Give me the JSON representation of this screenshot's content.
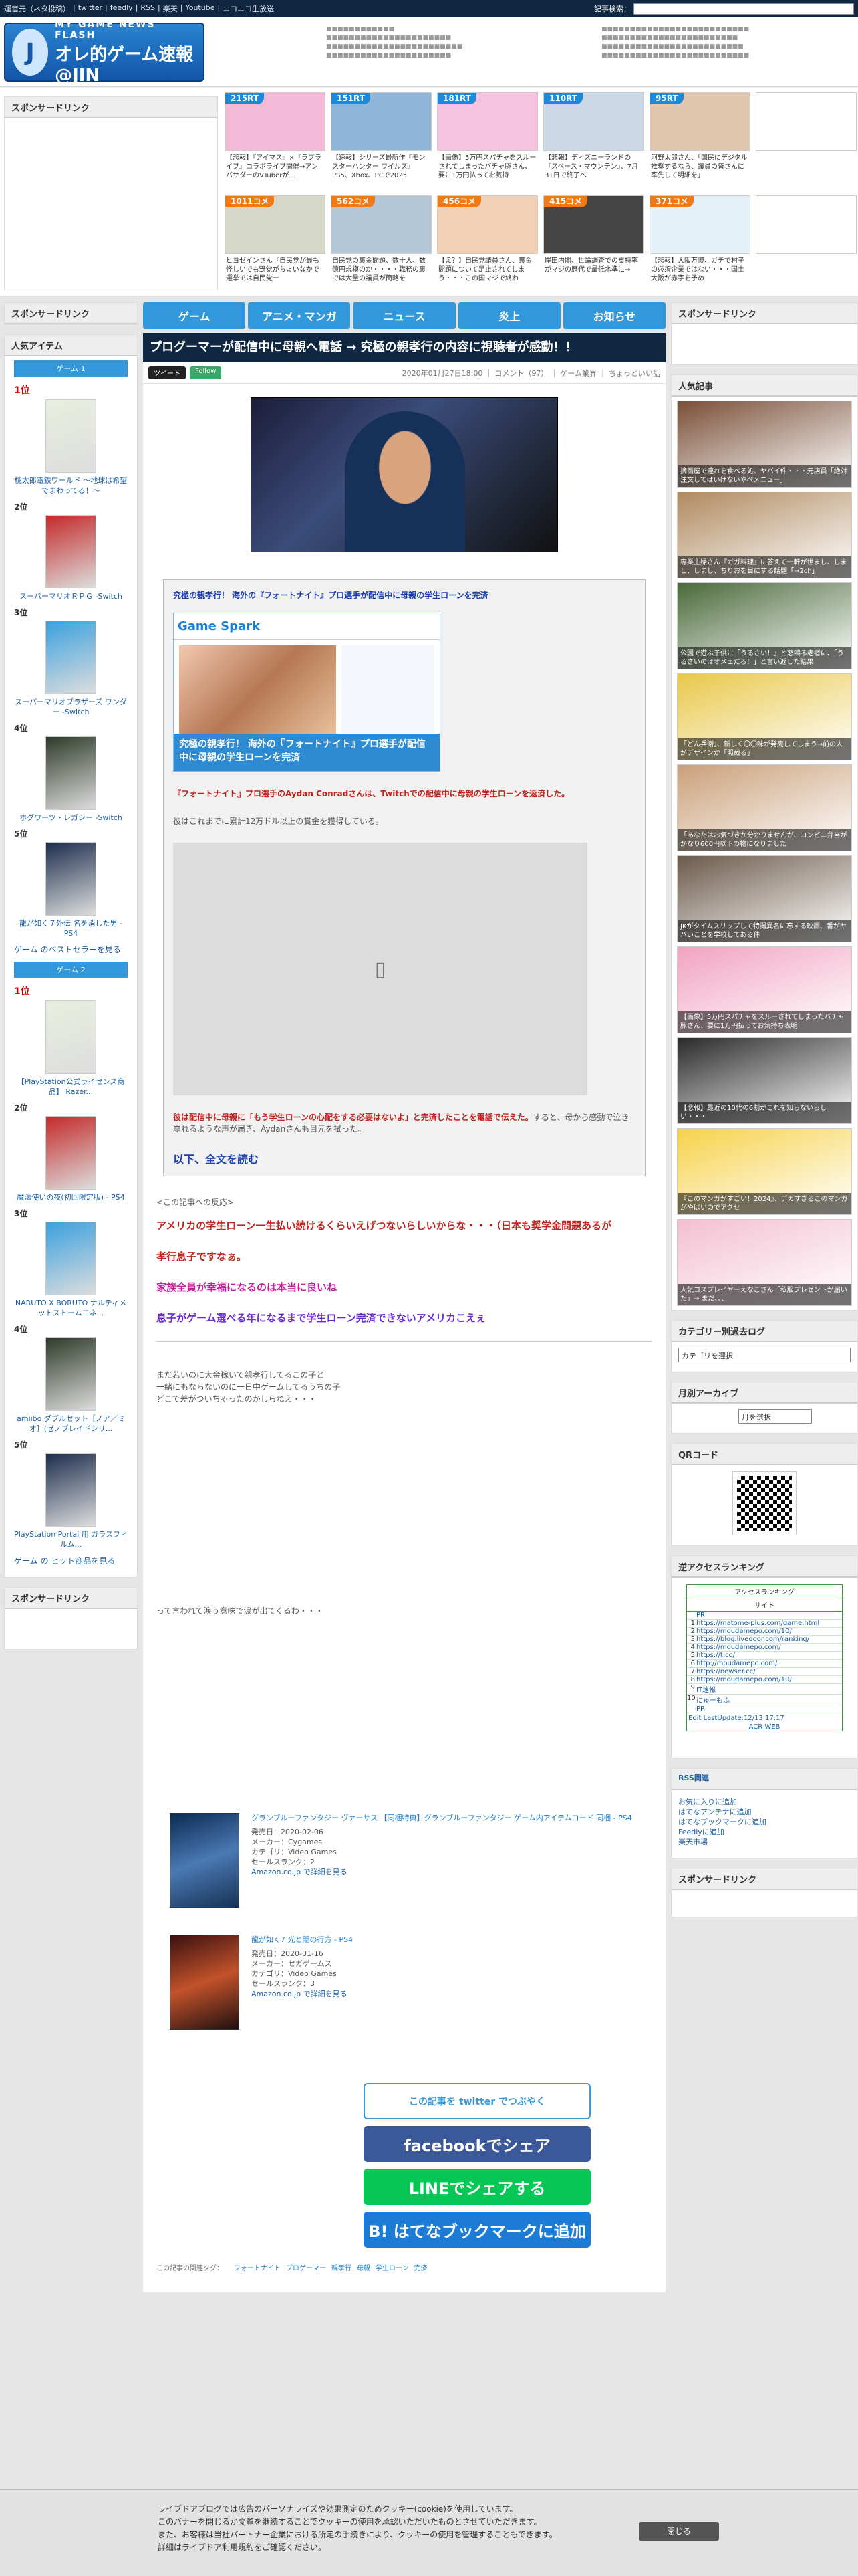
{
  "topbar": {
    "links": [
      "運営元（ネタ投稿）",
      "twitter",
      "feedly",
      "RSS",
      "楽天",
      "Youtube",
      "ニコニコ生放送"
    ],
    "search_label": "記事検索："
  },
  "header": {
    "logo_line1": "MY GAME NEWS FLASH",
    "logo_line2": "オレ的ゲーム速報@JIN"
  },
  "sponsor_title": "スポンサードリンク",
  "thumbs": [
    {
      "badge": "215RT",
      "caption": "【悲報】『アイマス』×『ラブライブ』コラボライブ開催→アンバサダーのVTuberが..."
    },
    {
      "badge": "151RT",
      "caption": "【速報】シリーズ最新作『モンスターハンター ワイルズ』PS5、Xbox、PCで2025"
    },
    {
      "badge": "181RT",
      "caption": "【画像】5万円スパチャをスルーされてしまったバチャ豚さん、要に1万円払ってお気持"
    },
    {
      "badge": "110RT",
      "caption": "【悲報】ディズニーランドの『スペース・マウンテン』、7月31日で終了へ"
    },
    {
      "badge": "95RT",
      "caption": "河野太郎さん、「国民にデジタル推奨するなら、議員の皆さんに率先して明細を」"
    },
    {
      "badge": "",
      "caption": ""
    },
    {
      "badge": "1011コメ",
      "caption": "ヒヨゼインさん『自民党が最も怪しいでも野党がちょいなかで選挙では自民党一"
    },
    {
      "badge": "562コメ",
      "caption": "自民党の裏金問題、数十人、数億円規模のか・・・・職務の裏では大量の議員が簡略を"
    },
    {
      "badge": "456コメ",
      "caption": "【え？】自民党議員さん、裏金問題について足止されてしまう・・・この国マジで終わ"
    },
    {
      "badge": "415コメ",
      "caption": "岸田内閣、世論調査での支持率がマジの歴代で最低水準に→"
    },
    {
      "badge": "371コメ",
      "caption": "【悲報】大阪万博、ガチで村子の必須企業ではない・・・国土大阪が赤字を予め"
    },
    {
      "badge": "",
      "caption": ""
    }
  ],
  "nav": [
    "ゲーム",
    "アニメ・マンガ",
    "ニュース",
    "炎上",
    "お知らせ"
  ],
  "article": {
    "title": "プログーマーが配信中に母親へ電話 → 究極の親孝行の内容に視聴者が感動！！",
    "tweet": "ツイート",
    "follow": "Follow",
    "meta": "2020年01月27日18:00 ｜ コメント（97） ｜ ゲーム業界 ｜ ちょっといい話",
    "quote_title": "究極の親孝行！ 海外の『フォートナイト』プロ選手が配信中に母親の学生ローンを完済",
    "card_site": "Game Spark",
    "card_bar": "究極の親孝行！ 海外の『フォートナイト』プロ選手が配信中に母親の学生ローンを完済",
    "lead_red": "『フォートナイト』プロ選手のAydan Conradさんは、Twitchでの配信中に母親の学生ローンを返済した。",
    "body1": "彼はこれまでに累計12万ドル以上の賞金を獲得している。",
    "body2_red": "彼は配信中に母親に「もう学生ローンの心配をする必要はないよ」と完済したことを電話で伝えた。",
    "body2_rest": "すると、母から感動で泣き崩れるような声が届き、Aydanさんも目元を拭った。",
    "more": "以下、全文を読む",
    "reactions_label": "<この記事への反応>",
    "reactions": [
      {
        "text": "アメリカの学生ローン一生払い続けるくらいえげつないらしいからな・・・（日本も奨学金問題あるが",
        "color": "#c0241e"
      },
      {
        "text": "孝行息子ですなぁ。",
        "color": "#c0241e"
      },
      {
        "text": "家族全員が幸福になるのは本当に良いね",
        "color": "#c0209a"
      },
      {
        "text": "息子がゲーム選べる年になるまで学生ローン完済できないアメリカこえぇ",
        "color": "#6a2bd0"
      }
    ],
    "aa_intro": "まだ若いのに大金稼いで親孝行してるこの子と\n一緒にもならないのに一日中ゲームしてるうちの子\nどこで差がついちゃったのかしらねえ・・・",
    "aa_outro": "って言われて涙う意味で涙が出てくるわ・・・",
    "products": [
      {
        "title": "グランブルーファンタジー ヴァーサス 【同梱特典】グランブルーファンタジー ゲーム内アイテムコード 同梱 - PS4",
        "lines": [
          "発売日：2020-02-06",
          "メーカー：Cygames",
          "カテゴリ：Video Games",
          "セールスランク：2"
        ],
        "link": "Amazon.co.jp で詳細を見る"
      },
      {
        "title": "龍が如く7 光と闇の行方 - PS4",
        "lines": [
          "発売日：2020-01-16",
          "メーカー：セガゲームス",
          "カテゴリ：Video Games",
          "セールスランク：3"
        ],
        "link": "Amazon.co.jp で詳細を見る"
      }
    ],
    "shares": [
      "この記事を twitter でつぶやく",
      "facebookでシェア",
      "LINEでシェアする",
      "B! はてなブックマークに追加"
    ],
    "tags_label": "この記事の関連タグ：",
    "tags": [
      "フォートナイト",
      "プロゲーマー",
      "親孝行",
      "母親",
      "学生ローン",
      "完済"
    ]
  },
  "left": {
    "popular_items": "人気アイテム",
    "tab1": "ゲーム 1",
    "ranking1": [
      {
        "rank": "1位",
        "name": "桃太郎電鉄ワールド ～地球は希望でまわってる！～"
      },
      {
        "rank": "2位",
        "name": "スーパーマリオＲＰＧ -Switch"
      },
      {
        "rank": "3位",
        "name": "スーパーマリオブラザーズ ワンダー -Switch"
      },
      {
        "rank": "4位",
        "name": "ホグワーツ・レガシー -Switch"
      },
      {
        "rank": "5位",
        "name": "龍が如く７外伝 名を消した男 - PS4"
      }
    ],
    "more1": "ゲーム のベストセラーを見る",
    "tab2": "ゲーム 2",
    "ranking2": [
      {
        "rank": "1位",
        "name": "【PlayStation公式ライセンス商品】 Razer..."
      },
      {
        "rank": "2位",
        "name": "魔法使いの夜(初回限定版) - PS4"
      },
      {
        "rank": "3位",
        "name": "NARUTO X BORUTO ナルティメットストームコネ..."
      },
      {
        "rank": "4位",
        "name": "amiibo ダブルセット［ノア／ミオ］(ゼノブレイドシリ..."
      },
      {
        "rank": "5位",
        "name": "PlayStation Portal 用 ガラスフィルム..."
      }
    ],
    "more2": "ゲーム の ヒット商品を見る",
    "sponsor": "スポンサードリンク"
  },
  "right": {
    "sponsor": "スポンサードリンク",
    "popular": "人気記事",
    "popular_items": [
      "摘画屋で連れを食べる処、ヤバイ件・・・元店員「絶対注文してはいけないやべメニュー」",
      "専業主婦さん『ガガ料理』に答えて一軒が世まし、しまし、しまし、ちりおを目にする話題「→2ch」",
      "公園で遊ぶ子供に「うるさい！」と怒鳴る老者に、「うるさいのはオメェだろ！」と言い返した結果",
      "「どん兵衛」、新しく〇〇味が発売してしまう→前の人がデザインか「照哉る」",
      "「あなたはお気づきか分かりませんが、コンビニ弁当がかなり600円以下の物になりました",
      "JKがタイムスリップして特撮異名に忘する映画、番がヤバいことを学校してある件",
      "【画像】5万円スパチャをスルーされてしまったバチャ豚さん、要に1万円払ってお気持ち表明",
      "【悲報】最近の10代の6割がこれを知らないらしい・・・",
      "『このマンガがすごい！2024』、デカすぎるこのマンガがやばいのでアクセ",
      "人気コスプレイヤーえなこさん「私服プレゼントが届いた」→ まだ、、、"
    ],
    "cat_log": "カテゴリー別過去ログ",
    "cat_select": "カテゴリを選択",
    "archive": "月別アーカイブ",
    "archive_select": "月を選択",
    "qr": "QRコード",
    "reverse": "逆アクセスランキング",
    "acr_title": "アクセスランキング",
    "acr_site": "サイト",
    "acr_list": [
      "PR",
      "https://matome-plus.com/game.html",
      "https://moudamepo.com/10/",
      "https://blog.livedoor.com/ranking/",
      "https://moudamepo.com/",
      "https://t.co/",
      "http://moudamepo.com/",
      "https://newser.cc/",
      "https://moudamepo.com/10/",
      "IT速報",
      "にゅーもふ",
      "PR"
    ],
    "acr_edit": "Edit LastUpdate:12/13 17:17",
    "acr_web": "ACR WEB",
    "rss": "RSS関連",
    "rss_links": [
      "お気に入りに追加",
      "はてなアンテナに追加",
      "はてなブックマークに追加",
      "Feedlyに追加",
      "楽天市場"
    ],
    "sponsor2": "スポンサードリンク"
  },
  "cookie": {
    "text": "ライブドアブログでは広告のパーソナライズや効果測定のためクッキー(cookie)を使用しています。\nこのバナーを閉じるか閲覧を継続することでクッキーの使用を承認いただいたものとさせていただきます。\nまた、お客様は当社パートナー企業における所定の手続きにより、クッキーの使用を管理することもできます。\n詳細はライブドア利用規約をご確認ください。",
    "close": "閉じる"
  },
  "colors": {
    "navy": "#0f2740",
    "blue": "#3298dc",
    "red": "#c0241e"
  }
}
